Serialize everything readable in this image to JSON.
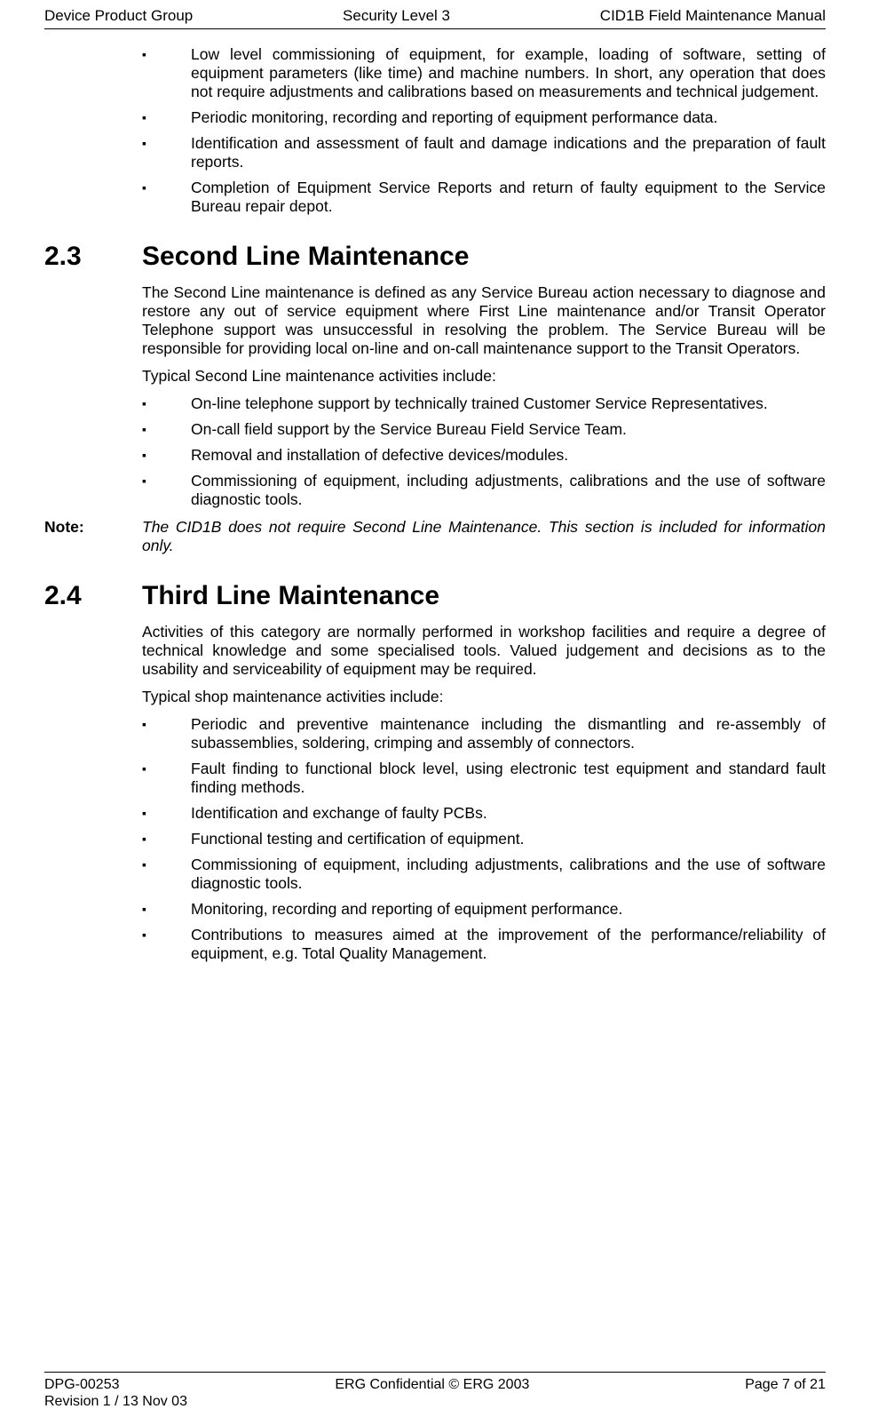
{
  "header": {
    "left": "Device Product Group",
    "center": "Security Level 3",
    "right": "CID1B Field Maintenance Manual"
  },
  "topBullets": [
    "Low level commissioning of equipment, for example, loading of software, setting of equipment parameters (like time) and machine numbers. In short, any operation that does not require adjustments and calibrations based on measurements and technical judgement.",
    "Periodic monitoring, recording and reporting of equipment performance data.",
    "Identification and assessment of fault and damage indications and the preparation of fault reports.",
    "Completion of Equipment Service Reports and return of faulty equipment to the Service Bureau repair depot."
  ],
  "sec23": {
    "num": "2.3",
    "title": "Second Line Maintenance",
    "para1": "The Second Line maintenance is defined as any Service Bureau action necessary to diagnose and restore any out of service equipment where First Line maintenance and/or Transit Operator Telephone support was unsuccessful in resolving the problem. The Service Bureau will be responsible for providing local on-line and on-call maintenance support to the Transit Operators.",
    "para2": "Typical Second Line maintenance activities include:",
    "bullets": [
      "On-line telephone support by technically trained Customer Service Representatives.",
      "On-call field support by the Service Bureau Field Service Team.",
      "Removal and installation of defective devices/modules.",
      "Commissioning of equipment, including adjustments, calibrations and the use of software diagnostic tools."
    ]
  },
  "note": {
    "label": "Note:",
    "text": "The CID1B does not require Second Line Maintenance. This section is included for information only."
  },
  "sec24": {
    "num": "2.4",
    "title": "Third Line Maintenance",
    "para1": "Activities of this category are normally performed in workshop facilities and require a degree of technical knowledge and some specialised tools. Valued judgement and decisions as to the usability and serviceability of equipment may be required.",
    "para2": "Typical shop maintenance activities include:",
    "bullets": [
      "Periodic and preventive maintenance including the dismantling and re-assembly of subassemblies, soldering, crimping and assembly of connectors.",
      "Fault finding to functional block level, using electronic test equipment and standard fault finding methods.",
      "Identification and exchange of faulty PCBs.",
      "Functional testing and certification of equipment.",
      "Commissioning of equipment, including adjustments, calibrations and the use of software diagnostic tools.",
      "Monitoring, recording and reporting of equipment performance.",
      "Contributions to measures aimed at the improvement of the performance/reliability of equipment, e.g. Total Quality Management."
    ]
  },
  "footer": {
    "leftTop": "DPG-00253",
    "leftBottom": "Revision 1 / 13 Nov 03",
    "center": "ERG Confidential © ERG 2003",
    "right": "Page 7 of 21"
  }
}
